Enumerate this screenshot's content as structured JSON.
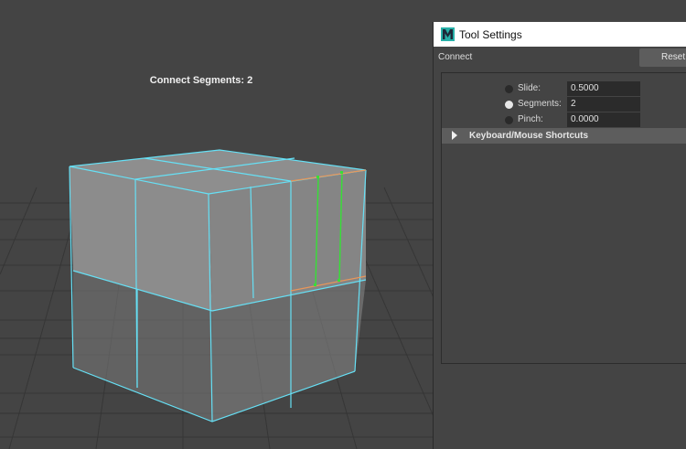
{
  "viewport": {
    "hud_text": "Connect Segments: 2"
  },
  "tool_settings": {
    "window_title": "Tool Settings",
    "logo_letter": "M",
    "tool_name": "Connect",
    "reset_button_label": "Reset T",
    "options": [
      {
        "label": "Slide:",
        "value": "0.5000",
        "selected": false
      },
      {
        "label": "Segments:",
        "value": "2",
        "selected": true
      },
      {
        "label": "Pinch:",
        "value": "0.0000",
        "selected": false
      }
    ],
    "section_header": "Keyboard/Mouse Shortcuts"
  },
  "colors": {
    "wireframe": "#66e0f5",
    "new_edges": "#36e036",
    "selected_edges": "#e8965a",
    "logo": "#27b0a8"
  }
}
